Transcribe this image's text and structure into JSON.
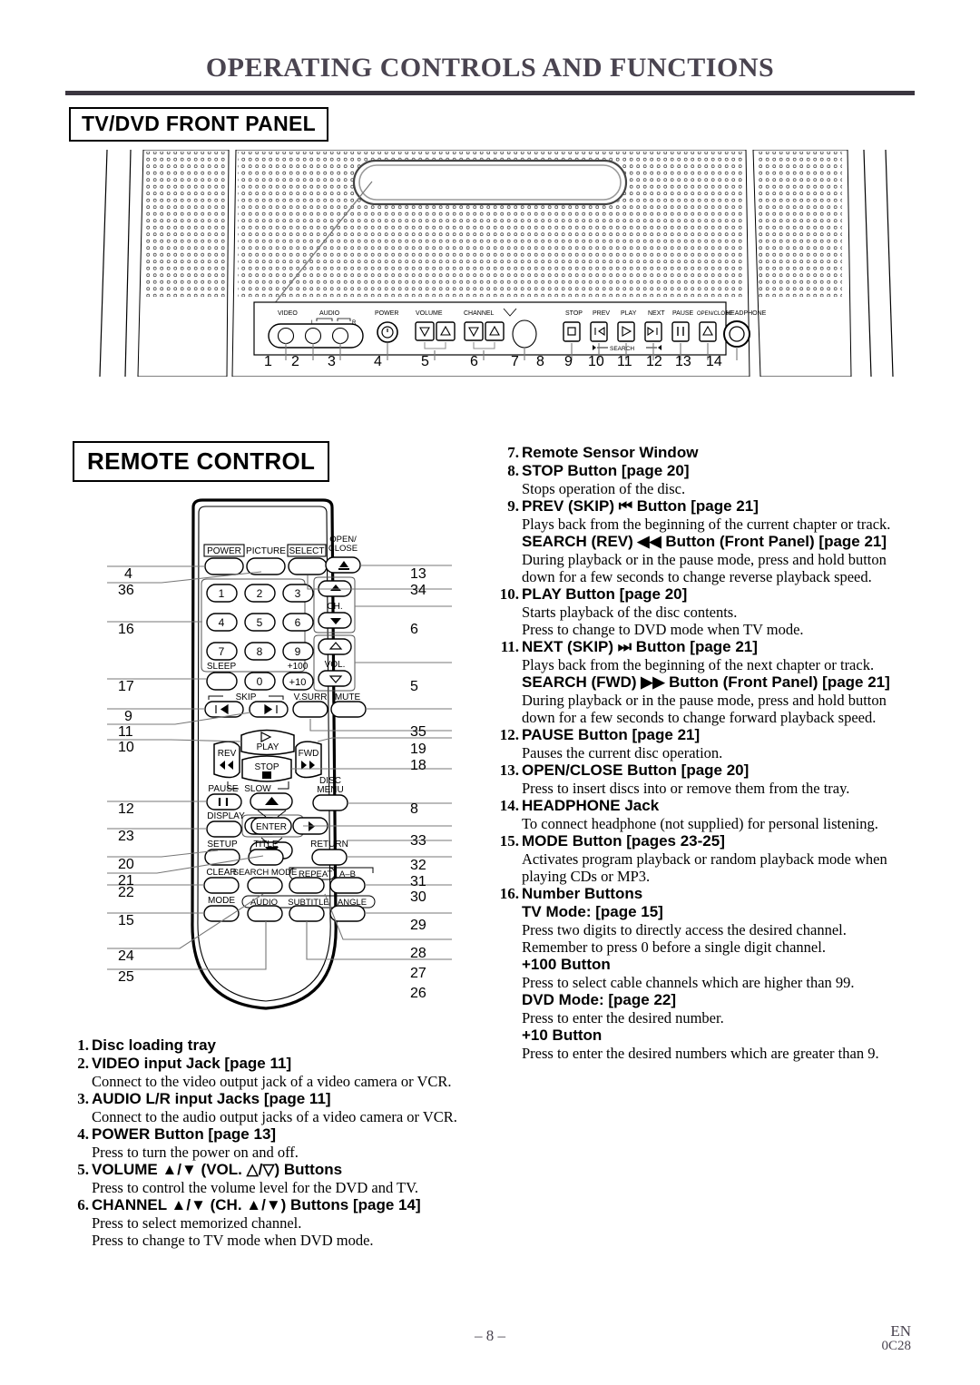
{
  "document": {
    "title": "OPERATING CONTROLS AND FUNCTIONS",
    "footer_page": "– 8 –",
    "footer_lang": "EN",
    "footer_code": "0C28"
  },
  "sections": {
    "front_panel_heading": "TV/DVD FRONT PANEL",
    "remote_heading": "REMOTE CONTROL"
  },
  "front_panel": {
    "labels": [
      "VIDEO",
      "AUDIO",
      "L",
      "R",
      "POWER",
      "VOLUME",
      "CHANNEL",
      "STOP",
      "PREV",
      "PLAY",
      "NEXT",
      "PAUSE",
      "OPEN/CLOSE",
      "HEADPHONE"
    ],
    "search_label": "SEARCH",
    "callouts": [
      "1",
      "2",
      "3",
      "4",
      "5",
      "6",
      "7",
      "8",
      "9",
      "10",
      "11",
      "12",
      "13",
      "14"
    ]
  },
  "remote": {
    "buttons": {
      "power": "POWER",
      "picture": "PICTURE",
      "select": "SELECT",
      "open_close": "OPEN/\nCLOSE",
      "open_close_l1": "OPEN/",
      "open_close_l2": "CLOSE",
      "num1": "1",
      "num2": "2",
      "num3": "3",
      "num4": "4",
      "num5": "5",
      "num6": "6",
      "num7": "7",
      "num8": "8",
      "num9": "9",
      "num0": "0",
      "plus100": "+100",
      "plus10": "+10",
      "sleep": "SLEEP",
      "skip": "SKIP",
      "vsurr": "V.SURR",
      "mute": "MUTE",
      "ch": "CH.",
      "vol": "VOL.",
      "play": "PLAY",
      "rev": "REV",
      "fwd": "FWD",
      "stop": "STOP",
      "pause": "PAUSE",
      "slow": "SLOW",
      "disc_menu_l1": "DISC",
      "disc_menu_l2": "MENU",
      "display": "DISPLAY",
      "enter": "ENTER",
      "setup": "SETUP",
      "title": "TITLE",
      "return": "RETURN",
      "clear": "CLEAR",
      "search_mode": "SEARCH MODE",
      "repeat": "REPEAT",
      "ab": "A-B",
      "mode": "MODE",
      "audio": "AUDIO",
      "subtitle": "SUBTITLE",
      "angle": "ANGLE"
    },
    "callouts_left": [
      "4",
      "36",
      "16",
      "17",
      "9",
      "11",
      "10",
      "12",
      "23",
      "20",
      "21",
      "22",
      "15",
      "24",
      "25"
    ],
    "callouts_right": [
      "13",
      "34",
      "6",
      "5",
      "35",
      "19",
      "18",
      "8",
      "33",
      "32",
      "31",
      "30",
      "29",
      "28",
      "27",
      "26"
    ]
  },
  "left_column": [
    {
      "num": "1.",
      "title": "Disc loading tray",
      "body": []
    },
    {
      "num": "2.",
      "title": "VIDEO input Jack [page 11]",
      "body": [
        "Connect to the video output jack of a video camera or VCR."
      ]
    },
    {
      "num": "3.",
      "title": "AUDIO L/R input Jacks [page 11]",
      "body": [
        "Connect to the audio output jacks of a video camera or VCR."
      ]
    },
    {
      "num": "4.",
      "title": "POWER Button [page 13]",
      "body": [
        "Press to turn the power on and off."
      ]
    },
    {
      "num": "5.",
      "title": "VOLUME ▲/▼ (VOL. △/▽) Buttons",
      "body": [
        "Press to control the volume level for the DVD and TV."
      ]
    },
    {
      "num": "6.",
      "title": "CHANNEL ▲/▼ (CH. ▲/▼) Buttons [page 14]",
      "body": [
        "Press to select memorized channel.",
        "Press to change to TV mode when DVD mode."
      ]
    }
  ],
  "right_column": [
    {
      "num": "7.",
      "title": "Remote Sensor Window",
      "body": []
    },
    {
      "num": "8.",
      "title": "STOP Button [page 20]",
      "body": [
        "Stops operation of the disc."
      ]
    },
    {
      "num": "9.",
      "title": "PREV (SKIP) ⏮ Button [page 21]",
      "body": [
        "Plays back from the beginning of the current chapter or track."
      ],
      "sub": {
        "title": "SEARCH (REV) ◀◀ Button (Front Panel) [page 21]",
        "body": [
          "During playback or in the pause mode, press and hold button down for a few seconds to change reverse playback speed."
        ]
      }
    },
    {
      "num": "10.",
      "title": "PLAY Button [page 20]",
      "body": [
        "Starts playback of the disc contents.",
        "Press to change to DVD mode when TV mode."
      ]
    },
    {
      "num": "11.",
      "title": "NEXT (SKIP) ⏭ Button [page 21]",
      "body": [
        "Plays back from the beginning of the next chapter or track."
      ],
      "sub": {
        "title": "SEARCH (FWD) ▶▶ Button (Front Panel) [page 21]",
        "body": [
          "During playback or in the pause mode, press and hold button down for a few seconds to change forward playback speed."
        ]
      }
    },
    {
      "num": "12.",
      "title": "PAUSE Button [page 21]",
      "body": [
        "Pauses the current disc operation."
      ]
    },
    {
      "num": "13.",
      "title": "OPEN/CLOSE Button [page 20]",
      "body": [
        "Press to insert discs into or remove them from the tray."
      ]
    },
    {
      "num": "14.",
      "title": "HEADPHONE Jack",
      "body": [
        "To connect headphone (not supplied) for personal listening."
      ]
    },
    {
      "num": "15.",
      "title": "MODE Button [pages 23-25]",
      "body": [
        "Activates program playback or random playback mode when playing CDs or MP3."
      ]
    },
    {
      "num": "16.",
      "title": "Number Buttons",
      "body": [],
      "subs": [
        {
          "title": "TV Mode: [page 15]",
          "body": [
            "Press two digits to directly access the desired channel.",
            "Remember to press 0 before a single digit channel."
          ]
        },
        {
          "title": "+100 Button",
          "body": [
            "Press to select cable channels which are higher than 99."
          ]
        },
        {
          "title": "DVD Mode: [page 22]",
          "body": [
            "Press to enter the desired number."
          ]
        },
        {
          "title": "+10 Button",
          "body": [
            "Press to enter the desired numbers which are greater than 9."
          ]
        }
      ]
    }
  ]
}
